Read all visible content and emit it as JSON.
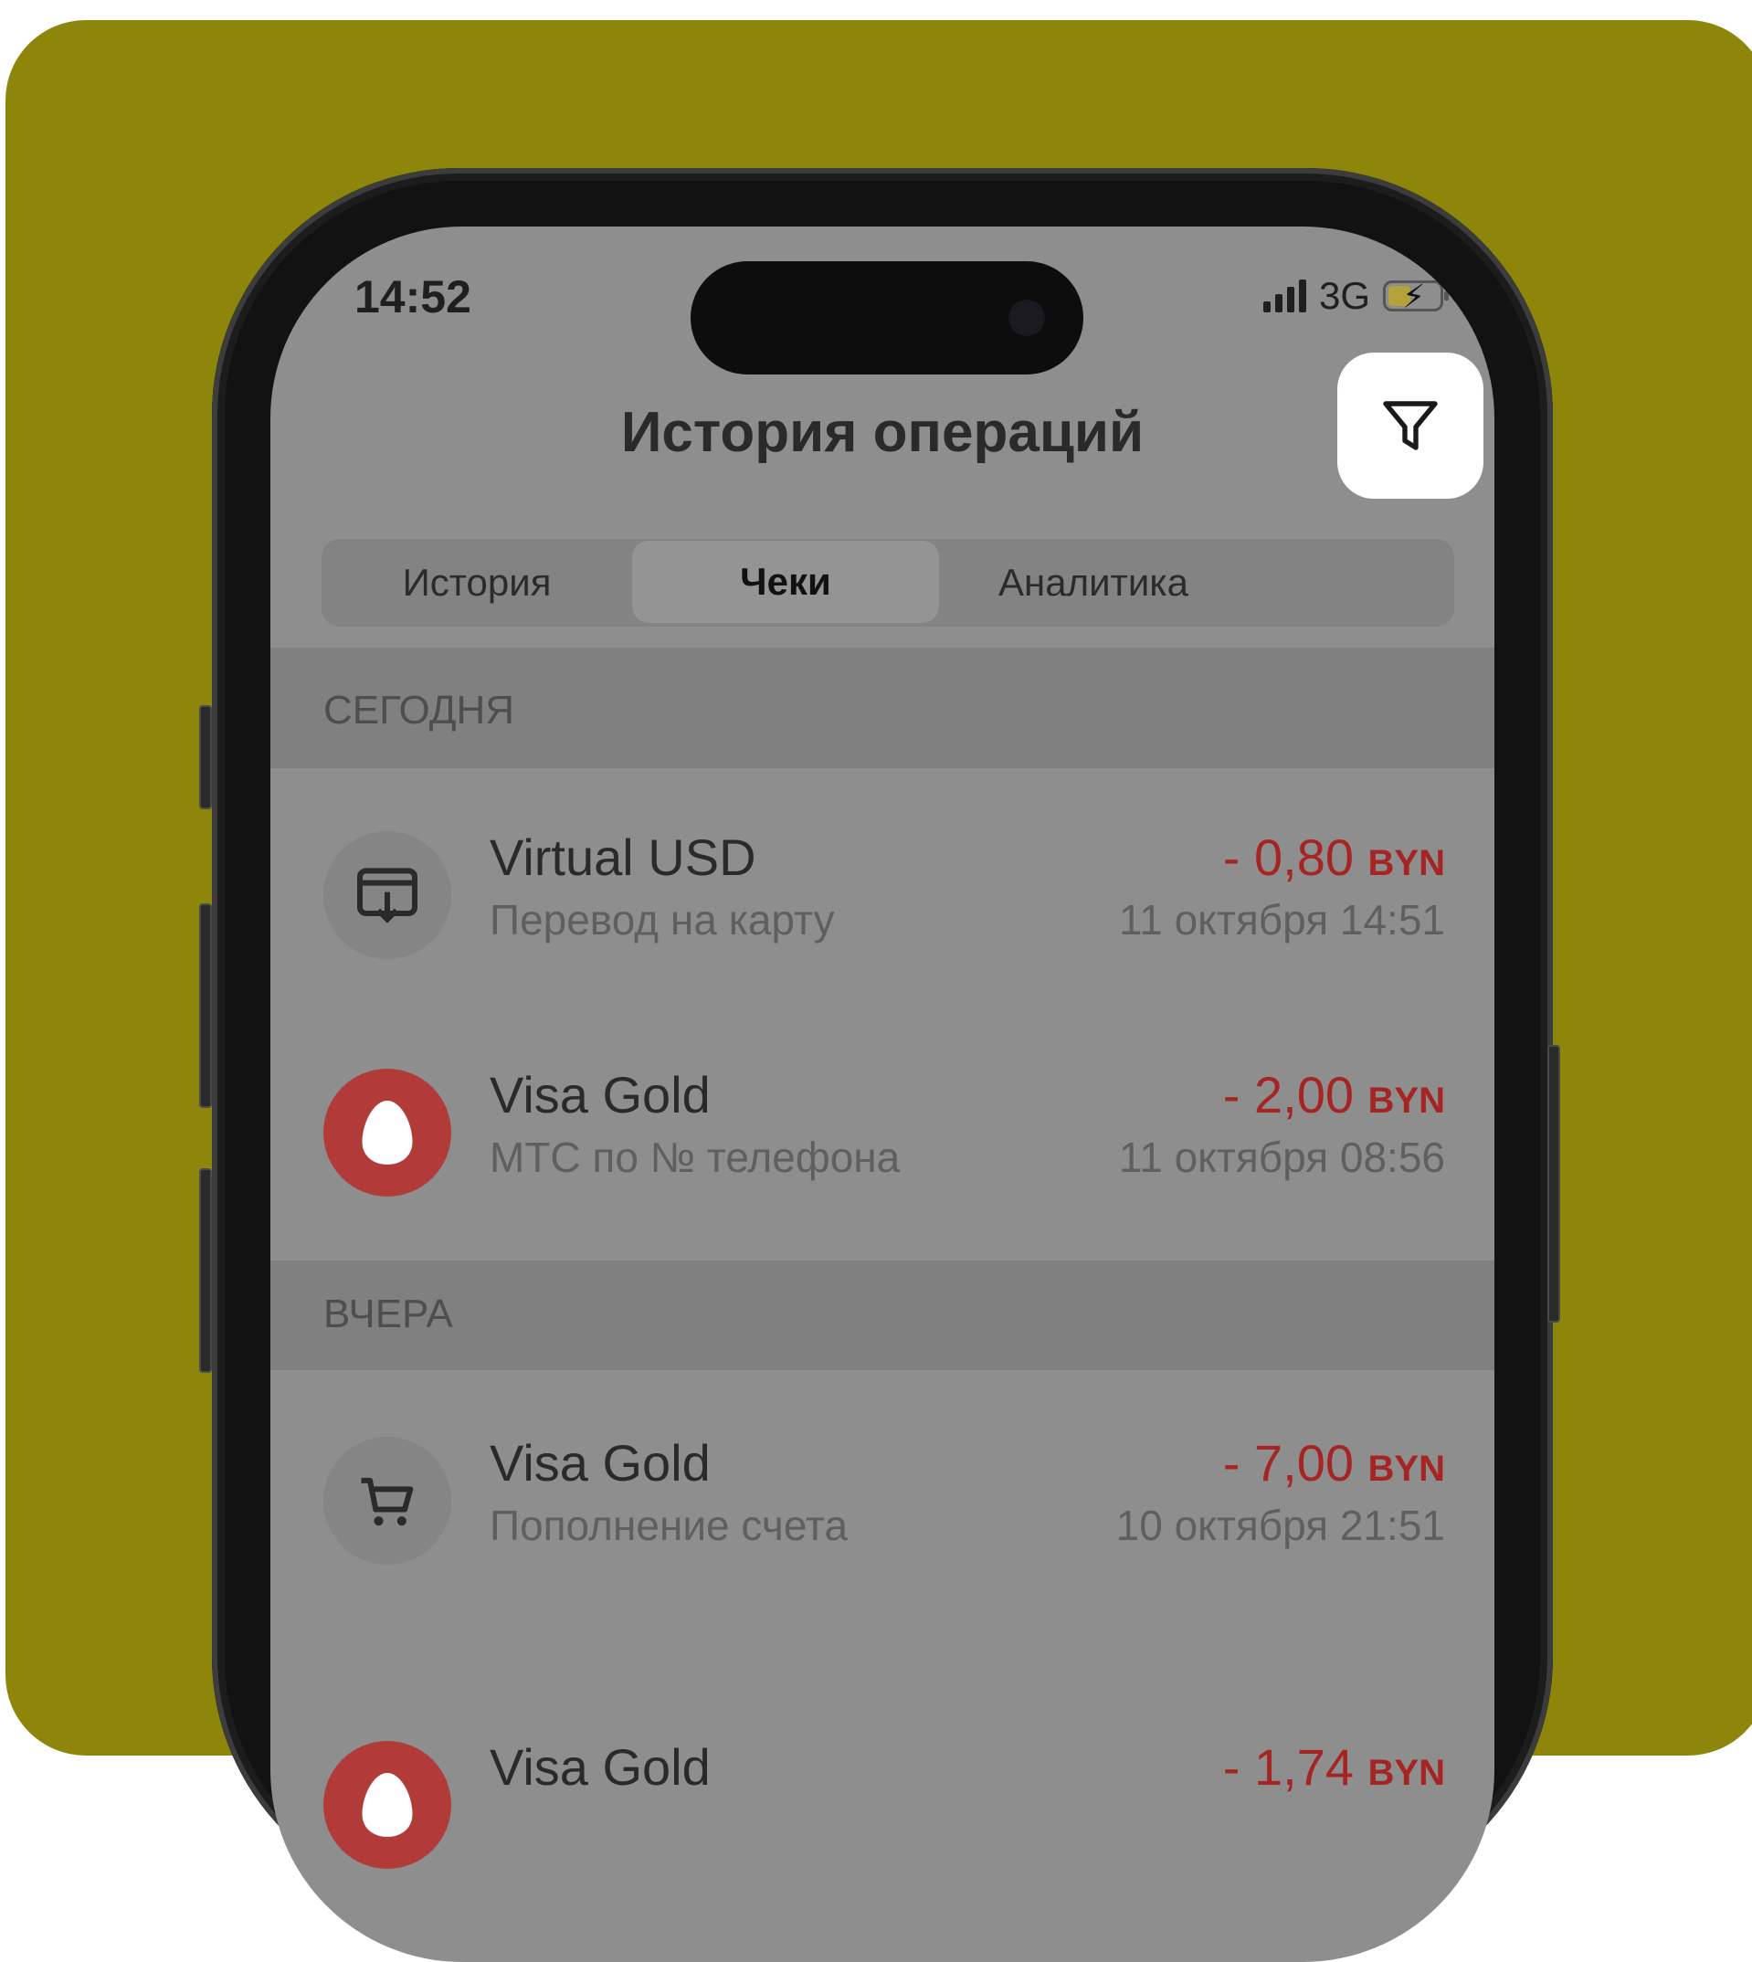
{
  "status_bar": {
    "time": "14:52",
    "network": "3G"
  },
  "header": {
    "title": "История операций",
    "filter_icon": "filter-funnel-icon"
  },
  "tabs": [
    {
      "label": "История",
      "active": false
    },
    {
      "label": "Чеки",
      "active": true
    },
    {
      "label": "Аналитика",
      "active": false
    }
  ],
  "sections": [
    {
      "label": "СЕГОДНЯ",
      "items": [
        {
          "title": "Virtual USD",
          "subtitle": "Перевод на карту",
          "amount": "- 0,80",
          "currency": "BYN",
          "date": "11 октября 14:51",
          "icon": "transfer-to-card-icon"
        },
        {
          "title": "Visa Gold",
          "subtitle": "МТС по № телефона",
          "amount": "- 2,00",
          "currency": "BYN",
          "date": "11 октября 08:56",
          "icon": "mts-egg-logo"
        }
      ]
    },
    {
      "label": "ВЧЕРА",
      "items": [
        {
          "title": "Visa Gold",
          "subtitle": "Пополнение счета",
          "amount": "- 7,00",
          "currency": "BYN",
          "date": "10 октября 21:51",
          "icon": "shopping-cart-icon"
        },
        {
          "title": "Visa Gold",
          "subtitle": "",
          "amount": "- 1,74",
          "currency": "BYN",
          "date": "",
          "icon": "mts-egg-logo"
        }
      ]
    }
  ],
  "colors": {
    "background": "#8d860b",
    "amount_negative": "#a52524",
    "mts_red": "#b23b3a"
  }
}
